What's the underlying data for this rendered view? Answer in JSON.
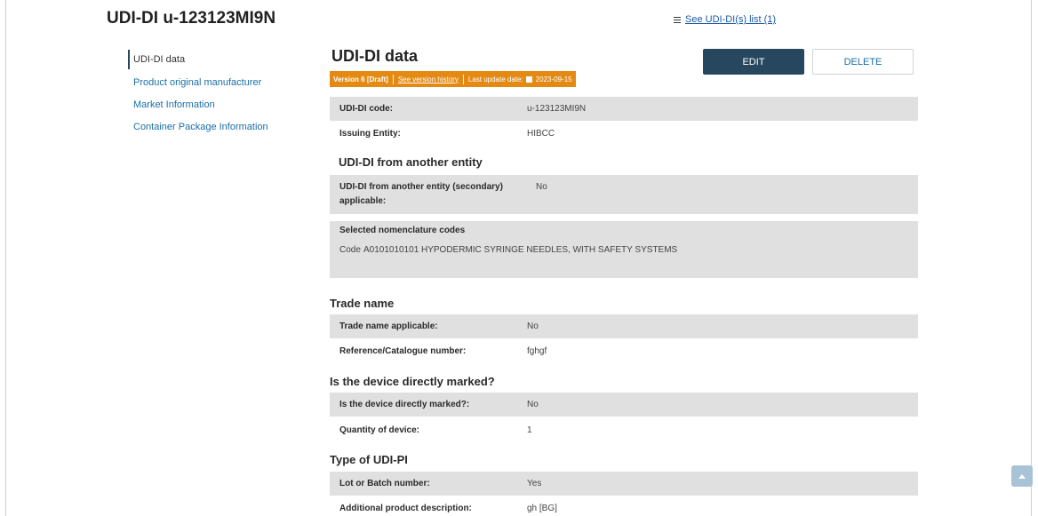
{
  "page": {
    "title": "UDI-DI u-123123MI9N"
  },
  "header": {
    "udi_list_link": "See UDI-DI(s) list (1)"
  },
  "sidebar": {
    "items": [
      {
        "label": "UDI-DI data"
      },
      {
        "label": "Product original manufacturer"
      },
      {
        "label": "Market Information"
      },
      {
        "label": "Container Package Information"
      }
    ]
  },
  "main": {
    "title": "UDI-DI data",
    "version": {
      "label": "Version 6",
      "status": "[Draft]",
      "history_link": "See version history",
      "last_update_label": "Last update date:",
      "last_update_date": "2023-09-15"
    },
    "buttons": {
      "edit": "EDIT",
      "delete": "DELETE"
    },
    "fields": {
      "udi_di_code": {
        "label": "UDI-DI code:",
        "value": "u-123123MI9N"
      },
      "issuing_entity": {
        "label": "Issuing Entity:",
        "value": "HIBCC"
      }
    },
    "udi_from_another_entity": {
      "heading": "UDI-DI from another entity",
      "secondary": {
        "label_line1": "UDI-DI from another entity (secondary)",
        "label_line2": "applicable:",
        "value": "No"
      },
      "nomenclature": {
        "label": "Selected nomenclature codes",
        "code_prefix": "Code",
        "code": "A0101010101",
        "description": "HYPODERMIC SYRINGE NEEDLES, WITH SAFETY SYSTEMS"
      }
    },
    "trade_name": {
      "heading": "Trade name",
      "applicable": {
        "label": "Trade name applicable:",
        "value": "No"
      },
      "reference": {
        "label": "Reference/Catalogue number:",
        "value": "fghgf"
      }
    },
    "direct_marking": {
      "heading": "Is the device directly marked?",
      "marked": {
        "label": "Is the device directly marked?:",
        "value": "No"
      },
      "quantity": {
        "label": "Quantity of device:",
        "value": "1"
      }
    },
    "udi_pi": {
      "heading": "Type of UDI-PI",
      "lot": {
        "label": "Lot or Batch number:",
        "value": "Yes"
      },
      "additional": {
        "label": "Additional product description:",
        "value": "gh [BG]"
      }
    }
  },
  "icons": {
    "list": "hamburger-icon",
    "calendar": "calendar-icon",
    "scroll_top": "caret-up-icon"
  },
  "colors": {
    "primary_button": "#27475e",
    "version_bar": "#e48a13",
    "link": "#1a6fa6",
    "row_shade": "#e0e0e0"
  }
}
